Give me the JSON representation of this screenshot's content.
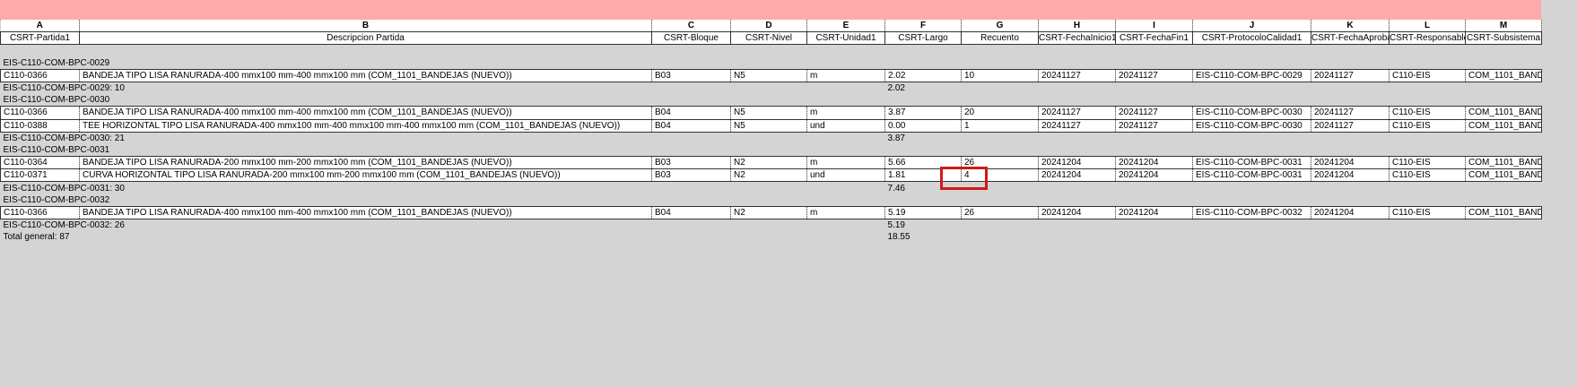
{
  "columns": [
    {
      "letter": "A",
      "header": "CSRT-Partida1"
    },
    {
      "letter": "B",
      "header": "Descripcion Partida"
    },
    {
      "letter": "C",
      "header": "CSRT-Bloque"
    },
    {
      "letter": "D",
      "header": "CSRT-Nivel"
    },
    {
      "letter": "E",
      "header": "CSRT-Unidad1"
    },
    {
      "letter": "F",
      "header": "CSRT-Largo"
    },
    {
      "letter": "G",
      "header": "Recuento"
    },
    {
      "letter": "H",
      "header": "CSRT-FechaInicio1"
    },
    {
      "letter": "I",
      "header": "CSRT-FechaFin1"
    },
    {
      "letter": "J",
      "header": "CSRT-ProtocoloCalidad1"
    },
    {
      "letter": "K",
      "header": "CSRT-FechaAproba"
    },
    {
      "letter": "L",
      "header": "CSRT-Responsable"
    },
    {
      "letter": "M",
      "header": "CSRT-Subsistema"
    }
  ],
  "groups": [
    {
      "title": "EIS-C110-COM-BPC-0029",
      "rows": [
        [
          "C110-0366",
          "BANDEJA TIPO LISA RANURADA-400 mmx100 mm-400 mmx100 mm (COM_1101_BANDEJAS (NUEVO))",
          "B03",
          "N5",
          "m",
          "2.02",
          "10",
          "20241127",
          "20241127",
          "EIS-C110-COM-BPC-0029",
          "20241127",
          "C110-EIS",
          "COM_1101_BANDE"
        ]
      ],
      "subtotal_label": "EIS-C110-COM-BPC-0029: 10",
      "subtotal_largo": "2.02"
    },
    {
      "title": "EIS-C110-COM-BPC-0030",
      "rows": [
        [
          "C110-0366",
          "BANDEJA TIPO LISA RANURADA-400 mmx100 mm-400 mmx100 mm (COM_1101_BANDEJAS (NUEVO))",
          "B04",
          "N5",
          "m",
          "3.87",
          "20",
          "20241127",
          "20241127",
          "EIS-C110-COM-BPC-0030",
          "20241127",
          "C110-EIS",
          "COM_1101_BANDE"
        ],
        [
          "C110-0388",
          "TEE HORIZONTAL TIPO LISA RANURADA-400 mmx100 mm-400 mmx100 mm-400 mmx100 mm (COM_1101_BANDEJAS (NUEVO))",
          "B04",
          "N5",
          "und",
          "0.00",
          "1",
          "20241127",
          "20241127",
          "EIS-C110-COM-BPC-0030",
          "20241127",
          "C110-EIS",
          "COM_1101_BANDE"
        ]
      ],
      "subtotal_label": "EIS-C110-COM-BPC-0030: 21",
      "subtotal_largo": "3.87"
    },
    {
      "title": "EIS-C110-COM-BPC-0031",
      "rows": [
        [
          "C110-0364",
          "BANDEJA TIPO LISA RANURADA-200 mmx100 mm-200 mmx100 mm (COM_1101_BANDEJAS (NUEVO))",
          "B03",
          "N2",
          "m",
          "5.66",
          "26",
          "20241204",
          "20241204",
          "EIS-C110-COM-BPC-0031",
          "20241204",
          "C110-EIS",
          "COM_1101_BANDE"
        ],
        [
          "C110-0371",
          "CURVA HORIZONTAL TIPO LISA RANURADA-200 mmx100 mm-200 mmx100 mm (COM_1101_BANDEJAS (NUEVO))",
          "B03",
          "N2",
          "und",
          "1.81",
          "4",
          "20241204",
          "20241204",
          "EIS-C110-COM-BPC-0031",
          "20241204",
          "C110-EIS",
          "COM_1101_BANDE"
        ]
      ],
      "subtotal_label": "EIS-C110-COM-BPC-0031: 30",
      "subtotal_largo": "7.46"
    },
    {
      "title": "EIS-C110-COM-BPC-0032",
      "rows": [
        [
          "C110-0366",
          "BANDEJA TIPO LISA RANURADA-400 mmx100 mm-400 mmx100 mm (COM_1101_BANDEJAS (NUEVO))",
          "B04",
          "N2",
          "m",
          "5.19",
          "26",
          "20241204",
          "20241204",
          "EIS-C110-COM-BPC-0032",
          "20241204",
          "C110-EIS",
          "COM_1101_BANDE"
        ]
      ],
      "subtotal_label": "EIS-C110-COM-BPC-0032: 26",
      "subtotal_largo": "5.19"
    }
  ],
  "grand_total_label": "Total general: 87",
  "grand_total_largo": "18.55",
  "colors": {
    "top_band": "#ffaaaa",
    "background": "#d4d4d4",
    "highlight": "#d01919"
  }
}
